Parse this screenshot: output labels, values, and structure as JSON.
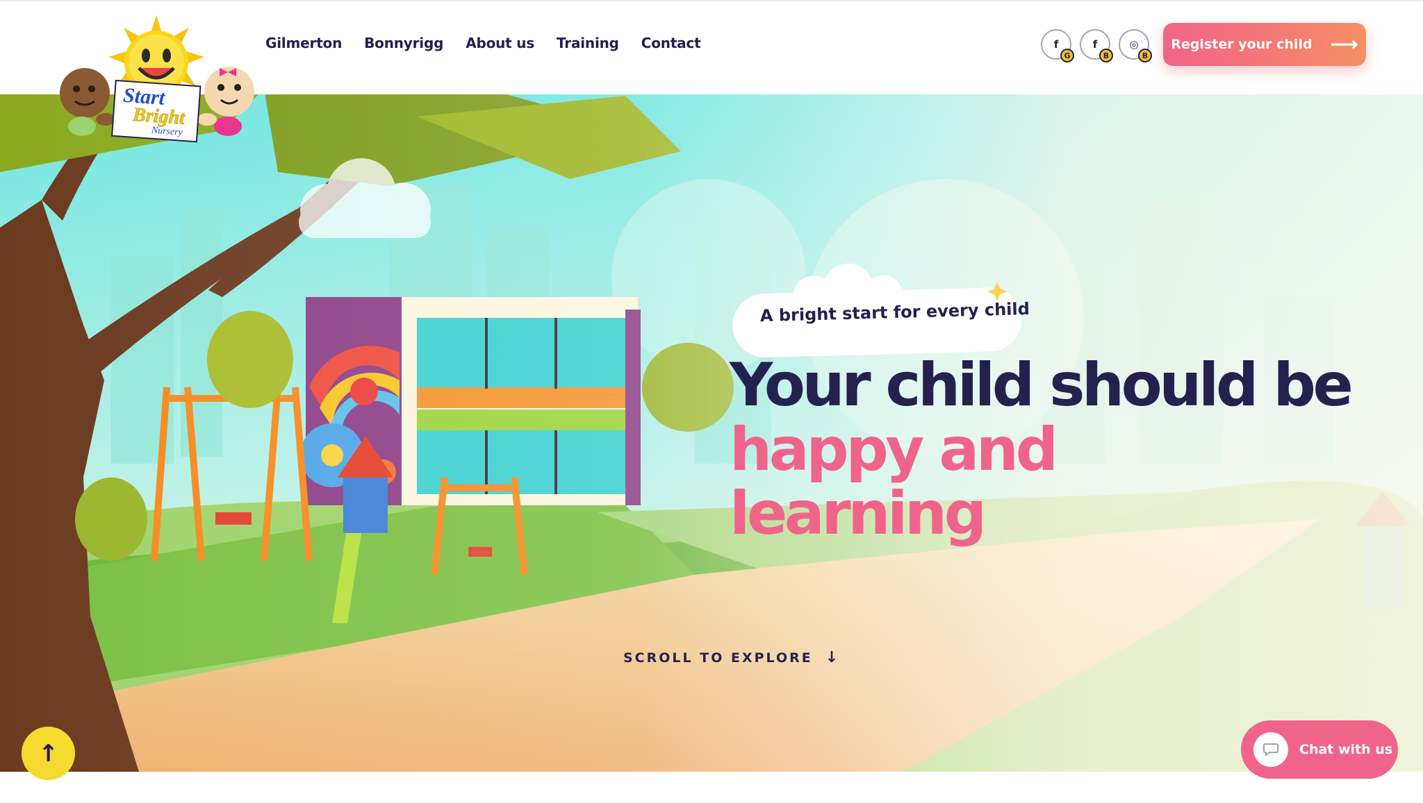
{
  "brand": {
    "logo_line1": "Start",
    "logo_line2": "Bright",
    "logo_line3": "Nursery"
  },
  "nav": {
    "items": [
      {
        "label": "Gilmerton"
      },
      {
        "label": "Bonnyrigg"
      },
      {
        "label": "About us"
      },
      {
        "label": "Training"
      },
      {
        "label": "Contact"
      }
    ]
  },
  "socials": [
    {
      "icon": "facebook-icon",
      "glyph": "f",
      "tag": "G"
    },
    {
      "icon": "facebook-icon",
      "glyph": "f",
      "tag": "B"
    },
    {
      "icon": "instagram-icon",
      "glyph": "◎",
      "tag": "B"
    }
  ],
  "header": {
    "register_label": "Register your child",
    "register_arrow": "⟶"
  },
  "hero": {
    "badge": "A bright start for every child",
    "headline_line1": "Your child should be",
    "headline_line2": "happy and learning",
    "scroll_label": "SCROLL TO EXPLORE",
    "scroll_arrow": "↓"
  },
  "floating": {
    "to_top_arrow": "↑",
    "chat_label": "Chat with us",
    "chat_icon": "💬"
  },
  "colors": {
    "navy": "#24214f",
    "pink": "#f0648c",
    "coral": "#f47c72",
    "yellow": "#f6da2d"
  }
}
